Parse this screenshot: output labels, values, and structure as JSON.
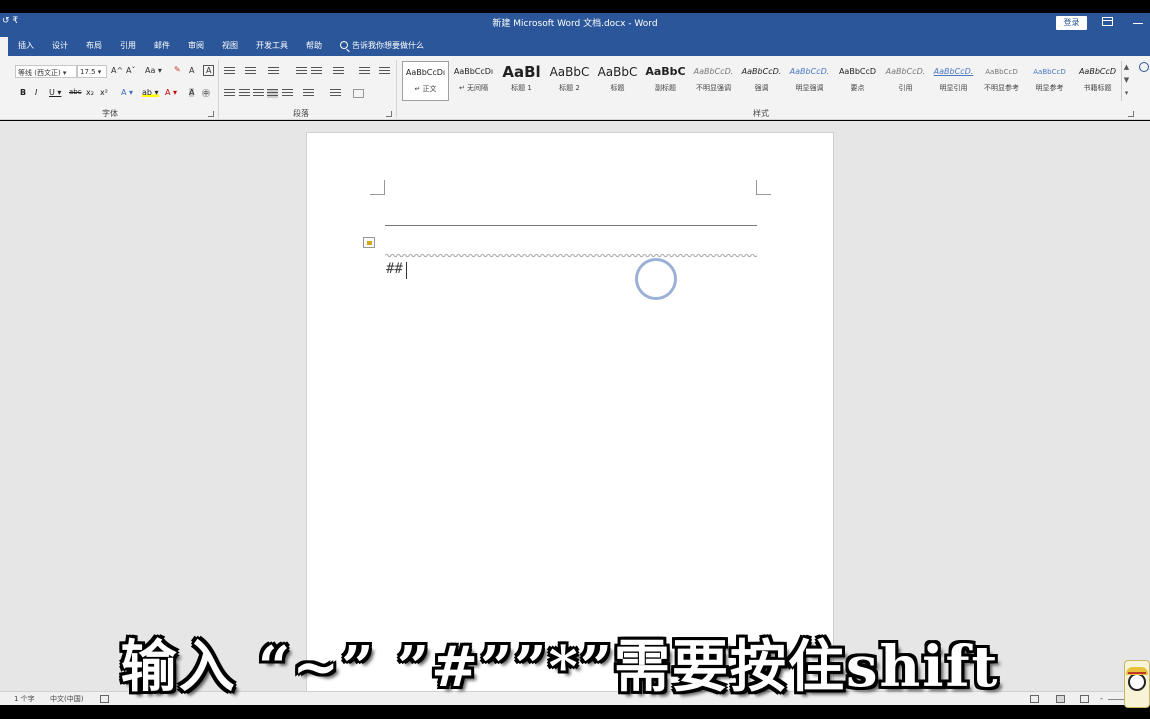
{
  "window": {
    "title": "新建 Microsoft Word 文档.docx  -  Word",
    "qat_label": "↺  ₹",
    "login_label": "登录"
  },
  "tabs": [
    "插入",
    "设计",
    "布局",
    "引用",
    "邮件",
    "审阅",
    "视图",
    "开发工具",
    "帮助"
  ],
  "tell_me": {
    "placeholder": "告诉我你想要做什么"
  },
  "ribbon": {
    "font_group": {
      "label": "字体",
      "font_name": "等线 (西文正) ▾",
      "font_size": "17.5 ▾",
      "grow": "A^",
      "shrink": "Aˇ",
      "change_case": "Aa ▾",
      "clear_fmt": "✎",
      "char_border": "A",
      "bold": "B",
      "italic": "I",
      "underline": "U ▾",
      "strike": "abc",
      "subscript": "x₂",
      "superscript": "x²",
      "text_effects": "A ▾",
      "highlight": "ab ▾",
      "font_color": "A ▾",
      "char_shading": "A",
      "enclose": "㊥"
    },
    "paragraph_group": {
      "label": "段落"
    },
    "styles_group": {
      "label": "样式",
      "items": [
        {
          "sample": "AaBbCcDı",
          "name": "↵ 正文"
        },
        {
          "sample": "AaBbCcDı",
          "name": "↵ 无间隔"
        },
        {
          "sample": "AaBl",
          "name": "标题 1"
        },
        {
          "sample": "AaBbC",
          "name": "标题 2"
        },
        {
          "sample": "AaBbC",
          "name": "标题"
        },
        {
          "sample": "AaBbC",
          "name": "副标题"
        },
        {
          "sample": "AaBbCcD.",
          "name": "不明显强调"
        },
        {
          "sample": "AaBbCcD.",
          "name": "强调"
        },
        {
          "sample": "AaBbCcD.",
          "name": "明显强调"
        },
        {
          "sample": "AaBbCcD",
          "name": "要点"
        },
        {
          "sample": "AaBbCcD.",
          "name": "引用"
        },
        {
          "sample": "AaBbCcD.",
          "name": "明显引用"
        },
        {
          "sample": "AaBbCcD",
          "name": "不明显参考"
        },
        {
          "sample": "AaBbCcD",
          "name": "明显参考"
        },
        {
          "sample": "AaBbCcD",
          "name": "书籍标题"
        }
      ],
      "scroll_up": "▲",
      "scroll_down": "▼",
      "more": "▾"
    }
  },
  "document": {
    "text": "##"
  },
  "subtitle": "输入 “~” ”#””*”需要按住shift",
  "statusbar": {
    "word_count": "1 个字",
    "language": "中文(中国)",
    "zoom_minus": "-"
  },
  "colors": {
    "accent": "#2b579a",
    "ribbon_bg": "#f3f3f3",
    "doc_bg": "#e6e6e6"
  }
}
